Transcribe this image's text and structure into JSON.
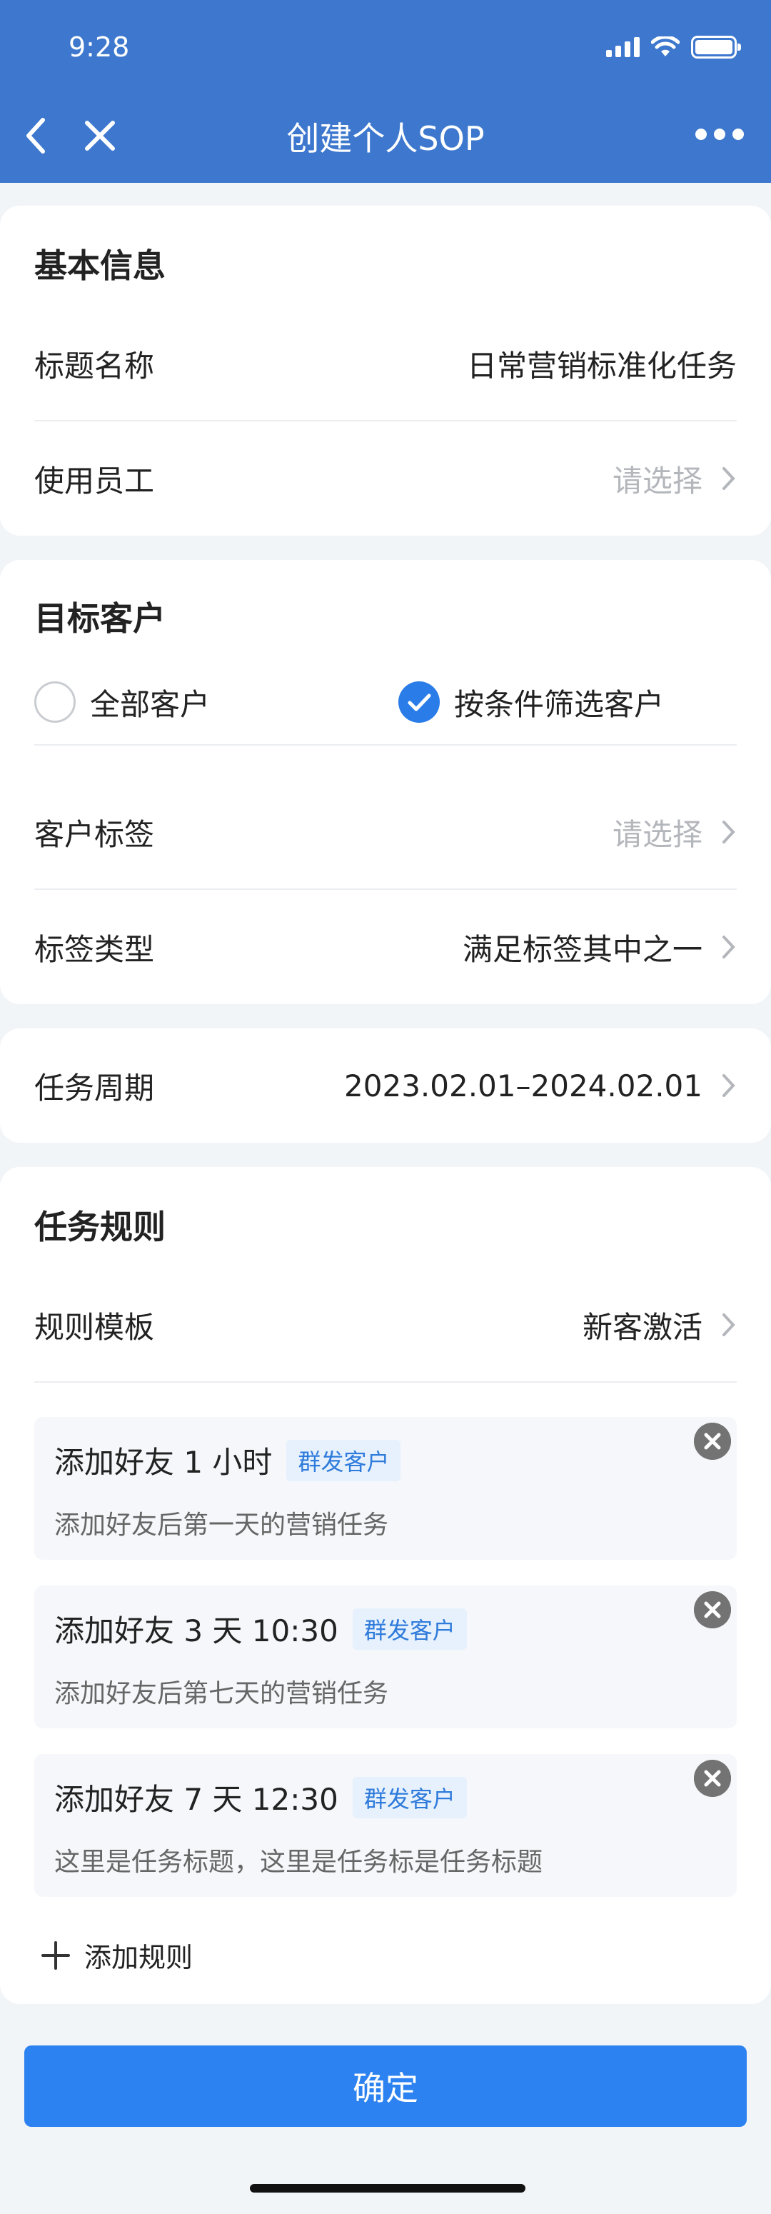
{
  "status_bar": {
    "time": "9:28"
  },
  "nav": {
    "title": "创建个人SOP"
  },
  "basic_info": {
    "title": "基本信息",
    "rows": [
      {
        "label": "标题名称",
        "value": "日常营销标准化任务"
      },
      {
        "label": "使用员工",
        "value": "请选择"
      }
    ]
  },
  "target_customers": {
    "title": "目标客户",
    "options": [
      {
        "label": "全部客户",
        "checked": false
      },
      {
        "label": "按条件筛选客户",
        "checked": true
      }
    ],
    "rows": [
      {
        "label": "客户标签",
        "value": "请选择"
      },
      {
        "label": "标签类型",
        "value": "满足标签其中之一"
      }
    ]
  },
  "task_period": {
    "label": "任务周期",
    "value": "2023.02.01–2024.02.01"
  },
  "task_rules": {
    "title": "任务规则",
    "template": {
      "label": "规则模板",
      "value": "新客激活"
    },
    "rules": [
      {
        "title": "添加好友 1 小时",
        "tag": "群发客户",
        "desc": "添加好友后第一天的营销任务"
      },
      {
        "title": "添加好友 3 天 10:30",
        "tag": "群发客户",
        "desc": "添加好友后第七天的营销任务"
      },
      {
        "title": "添加好友 7 天 12:30",
        "tag": "群发客户",
        "desc": "这里是任务标题，这里是任务标是任务标题"
      }
    ],
    "add_label": "添加规则"
  },
  "confirm_label": "确定",
  "colors": {
    "header": "#3D78CE",
    "primary": "#2B82F0",
    "tag_text": "#2F7BDB",
    "tag_bg": "#E6F1FD"
  }
}
